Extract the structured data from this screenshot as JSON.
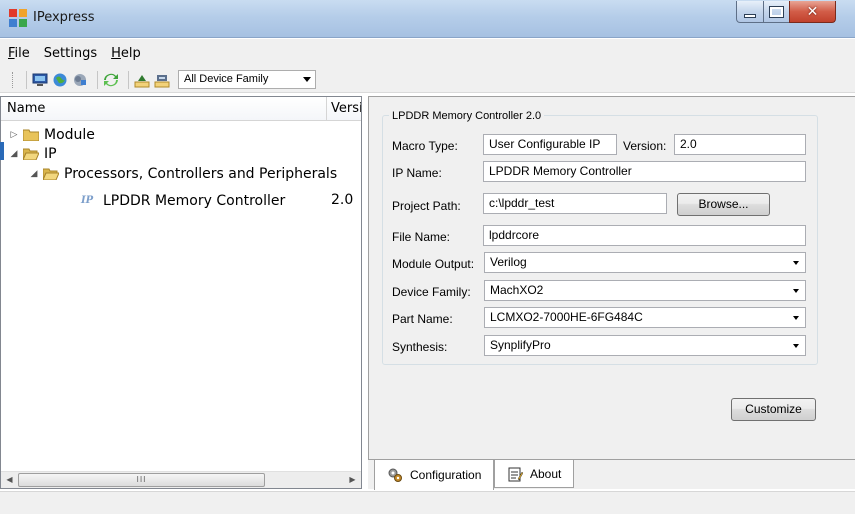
{
  "window": {
    "title": "IPexpress"
  },
  "menu": {
    "items": [
      {
        "label": "File",
        "mnemonic": "F",
        "rest": "ile"
      },
      {
        "label": "Settings",
        "mnemonic": "",
        "rest": "Settings"
      },
      {
        "label": "Help",
        "mnemonic": "H",
        "rest": "elp"
      }
    ]
  },
  "toolbar": {
    "icons": [
      "monitor-icon",
      "globe-icon",
      "network-icon",
      "refresh-icon",
      "tree-up-icon",
      "tree-down-icon"
    ],
    "device_family": "All Device Family"
  },
  "tree": {
    "col_name": "Name",
    "col_version": "Version",
    "nodes": [
      {
        "label": "Module",
        "expander": "▷",
        "level": 0
      },
      {
        "label": "IP",
        "expander": "◢",
        "level": 0
      },
      {
        "label": "Processors, Controllers and Peripherals",
        "expander": "◢",
        "level": 1
      },
      {
        "label": "LPDDR Memory Controller",
        "version": "2.0",
        "level": 2,
        "badge": "IP"
      }
    ],
    "scroll_thumb_text": "III"
  },
  "config": {
    "group_title": "LPDDR Memory Controller 2.0",
    "macro_type_label": "Macro Type:",
    "macro_type": "User Configurable IP",
    "version_label": "Version:",
    "version": "2.0",
    "ip_name_label": "IP Name:",
    "ip_name": "LPDDR Memory Controller",
    "project_path_label": "Project Path:",
    "project_path": "c:\\lpddr_test",
    "browse": "Browse...",
    "file_name_label": "File Name:",
    "file_name": "lpddrcore",
    "module_output_label": "Module Output:",
    "module_output": "Verilog",
    "device_family_label": "Device Family:",
    "device_family": "MachXO2",
    "part_name_label": "Part Name:",
    "part_name": "LCMXO2-7000HE-6FG484C",
    "synthesis_label": "Synthesis:",
    "synthesis": "SynplifyPro",
    "customize": "Customize"
  },
  "tabs": [
    {
      "label": "Configuration",
      "icon": "gears-icon",
      "active": true
    },
    {
      "label": "About",
      "icon": "notepad-icon",
      "active": false
    }
  ]
}
